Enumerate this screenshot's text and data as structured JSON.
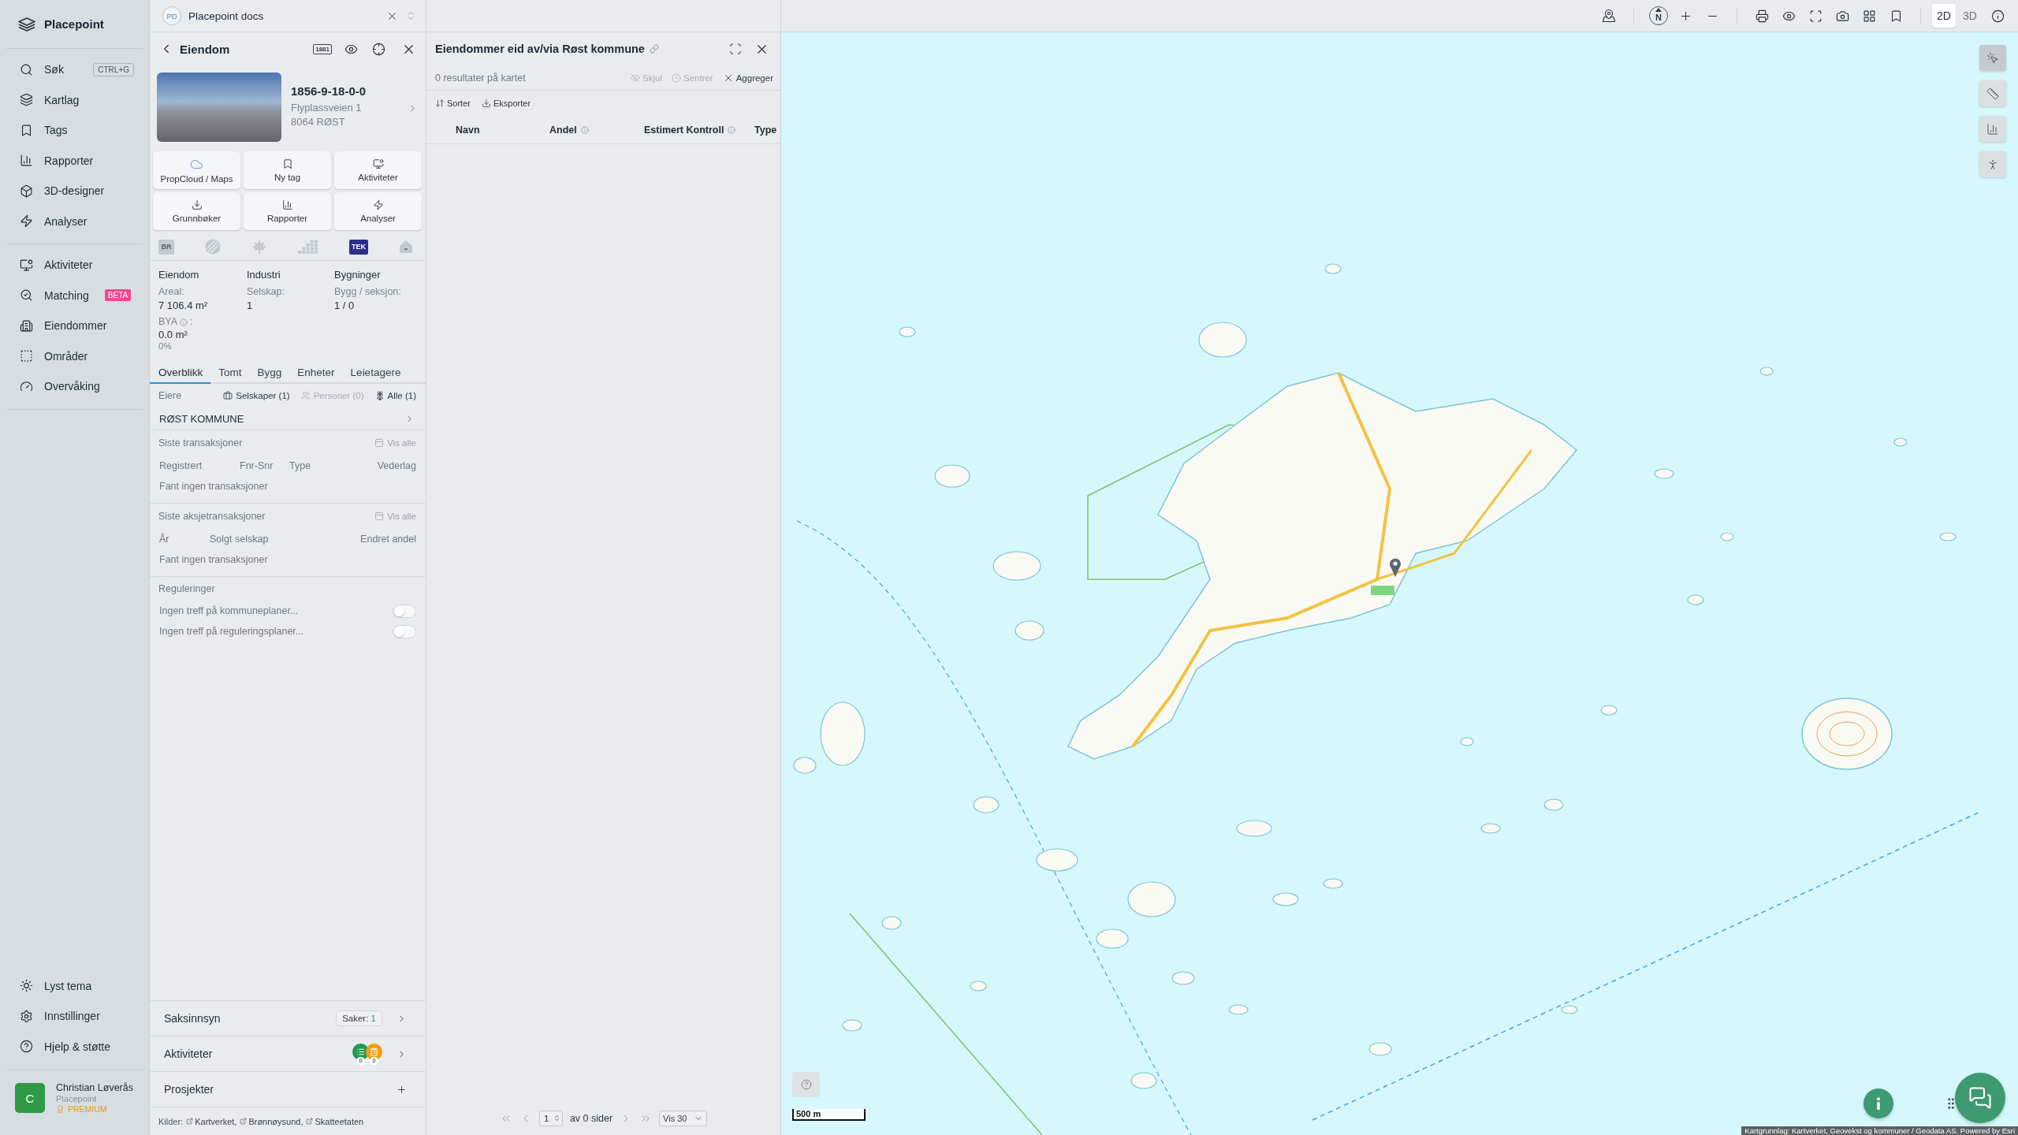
{
  "sidebar": {
    "brand": "Placepoint",
    "primary": [
      {
        "label": "Søk",
        "shortcut": "CTRL+G"
      },
      {
        "label": "Kartlag"
      },
      {
        "label": "Tags"
      },
      {
        "label": "Rapporter"
      },
      {
        "label": "3D-designer"
      },
      {
        "label": "Analyser"
      }
    ],
    "secondary": [
      {
        "label": "Aktiviteter"
      },
      {
        "label": "Matching",
        "badge": "BETA"
      },
      {
        "label": "Eiendommer"
      },
      {
        "label": "Områder"
      },
      {
        "label": "Overvåking"
      }
    ],
    "footer": [
      {
        "label": "Lyst tema"
      },
      {
        "label": "Innstillinger"
      },
      {
        "label": "Hjelp & støtte"
      }
    ],
    "user": {
      "initial": "C",
      "name": "Christian Løverås",
      "organization": "Placepoint",
      "plan": "PREMIUM"
    }
  },
  "workspace": {
    "initials": "PD",
    "name": "Placepoint docs"
  },
  "property_panel": {
    "title": "Eiendom",
    "directory": "1881",
    "property": {
      "id": "1856-9-18-0-0",
      "address": "Flyplassveien 1",
      "postcode": "8064 RØST"
    },
    "actions": [
      "PropCloud / Maps",
      "Ny tag",
      "Aktiviteter",
      "Grunnbøker",
      "Rapporter",
      "Analyser"
    ],
    "registries": [
      {
        "kind": "text",
        "label": "BR",
        "active": false
      },
      {
        "kind": "globe",
        "active": false
      },
      {
        "kind": "leaf",
        "active": false
      },
      {
        "kind": "bars",
        "active": false
      },
      {
        "kind": "text",
        "label": "TEK",
        "active": true
      },
      {
        "kind": "house",
        "active": false
      }
    ],
    "facts": [
      {
        "heading": "Eiendom",
        "fields": [
          {
            "label": "Areal:",
            "value": "7 106.4 m²"
          },
          {
            "label": "BYA",
            "info": true,
            "label_suffix": ":",
            "value": "0.0 m²",
            "note": "0%"
          }
        ]
      },
      {
        "heading": "Industri",
        "fields": [
          {
            "label": "Selskap:",
            "value": "1"
          }
        ]
      },
      {
        "heading": "Bygninger",
        "fields": [
          {
            "label": "Bygg / seksjon:",
            "value": "1 / 0"
          }
        ]
      }
    ],
    "tabs": [
      {
        "label": "Overblikk",
        "selected": true
      },
      {
        "label": "Tomt",
        "selected": false
      },
      {
        "label": "Bygg",
        "selected": false
      },
      {
        "label": "Enheter",
        "selected": false
      },
      {
        "label": "Leietagere",
        "selected": false
      }
    ],
    "owners": {
      "label": "Eiere",
      "filters": [
        {
          "label": "Selskaper (1)",
          "disabled": false
        },
        {
          "label": "Personer (0)",
          "disabled": true
        },
        {
          "label": "Alle (1)",
          "disabled": false
        }
      ],
      "rows": [
        "RØST KOMMUNE"
      ]
    },
    "transactions": [
      {
        "title": "Siste transaksjoner",
        "link": "Vis alle",
        "columns": [
          "Registrert",
          "Fnr-Snr",
          "Type",
          "Vederlag"
        ],
        "empty": "Fant ingen transaksjoner"
      },
      {
        "title": "Siste aksjetransaksjoner",
        "link": "Vis alle",
        "columns": [
          "År",
          "Solgt selskap",
          "Endret andel"
        ],
        "empty": "Fant ingen transaksjoner"
      }
    ],
    "regulations": {
      "title": "Reguleringer",
      "rows": [
        {
          "label": "Ingen treff på kommuneplaner...",
          "on": false
        },
        {
          "label": "Ingen treff på reguleringsplaner...",
          "on": false
        }
      ]
    },
    "sections": [
      {
        "kind": "cases",
        "label": "Saksinnsyn",
        "badge_label": "Saker:",
        "badge_value": "1"
      },
      {
        "kind": "activities",
        "label": "Aktiviteter",
        "activities": [
          {
            "count": "0",
            "color": "#1f9a4b"
          },
          {
            "count": "0",
            "color": "#f39c12"
          }
        ]
      },
      {
        "kind": "projects",
        "label": "Prosjekter"
      }
    ],
    "sources": {
      "label": "Kilder:",
      "links": [
        "Kartverket,",
        "Brønnøysund,",
        "Skatteetaten"
      ]
    }
  },
  "results_panel": {
    "title": "Eiendommer eid av/via Røst kommune",
    "summary": "0 resultater på kartet",
    "actions": [
      {
        "label": "Skjul",
        "disabled": true
      },
      {
        "label": "Sentrer",
        "disabled": true
      },
      {
        "label": "Aggreger",
        "disabled": false
      }
    ],
    "tools": [
      "Sorter",
      "Eksporter"
    ],
    "columns": [
      {
        "label": "Navn",
        "info": false
      },
      {
        "label": "Andel",
        "info": true
      },
      {
        "label": "Estimert Kontroll",
        "info": true
      },
      {
        "label": "Type",
        "info": false
      }
    ],
    "pagination": {
      "page": "1",
      "total": "av 0 sider",
      "page_size": "Vis 30"
    }
  },
  "map": {
    "compass": "N",
    "view_modes": [
      {
        "label": "2D",
        "selected": true
      },
      {
        "label": "3D",
        "selected": false
      }
    ],
    "tools": [
      {
        "selected": true
      },
      {
        "selected": false
      },
      {
        "selected": false
      },
      {
        "selected": false
      }
    ],
    "scale": "500 m",
    "attribution": "Kartgrunnlag: Kartverket, Geovekst og kommuner / Geodata AS. Powered by Esri"
  }
}
